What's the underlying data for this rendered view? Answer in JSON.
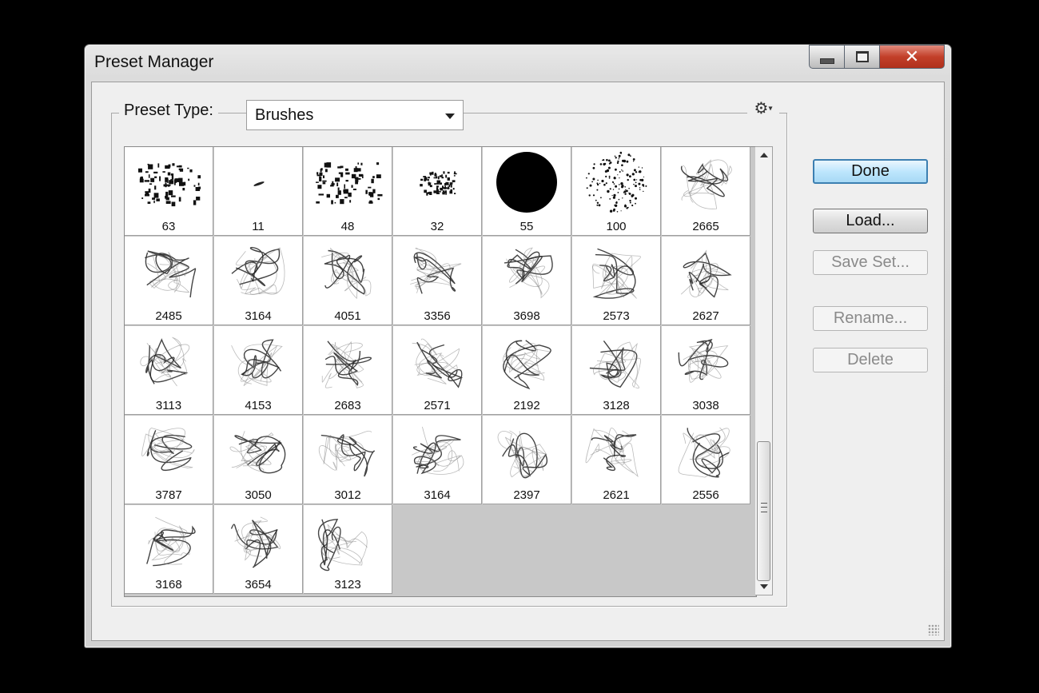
{
  "window": {
    "title": "Preset Manager",
    "close_glyph": "✕"
  },
  "preset": {
    "label": "Preset Type:",
    "selected": "Brushes"
  },
  "menu_icon": "gear-icon",
  "brushes": [
    {
      "size": "63",
      "kind": "splatter"
    },
    {
      "size": "11",
      "kind": "dash"
    },
    {
      "size": "48",
      "kind": "splatter"
    },
    {
      "size": "32",
      "kind": "splatter-small"
    },
    {
      "size": "55",
      "kind": "hard-round"
    },
    {
      "size": "100",
      "kind": "spatter-circle"
    },
    {
      "size": "2665",
      "kind": "smoke"
    },
    {
      "size": "2485",
      "kind": "smoke"
    },
    {
      "size": "3164",
      "kind": "smoke"
    },
    {
      "size": "4051",
      "kind": "smoke"
    },
    {
      "size": "3356",
      "kind": "smoke"
    },
    {
      "size": "3698",
      "kind": "smoke"
    },
    {
      "size": "2573",
      "kind": "smoke"
    },
    {
      "size": "2627",
      "kind": "smoke"
    },
    {
      "size": "3113",
      "kind": "smoke"
    },
    {
      "size": "4153",
      "kind": "smoke"
    },
    {
      "size": "2683",
      "kind": "smoke"
    },
    {
      "size": "2571",
      "kind": "smoke"
    },
    {
      "size": "2192",
      "kind": "smoke"
    },
    {
      "size": "3128",
      "kind": "smoke"
    },
    {
      "size": "3038",
      "kind": "smoke"
    },
    {
      "size": "3787",
      "kind": "smoke"
    },
    {
      "size": "3050",
      "kind": "smoke"
    },
    {
      "size": "3012",
      "kind": "smoke"
    },
    {
      "size": "3164",
      "kind": "smoke"
    },
    {
      "size": "2397",
      "kind": "smoke"
    },
    {
      "size": "2621",
      "kind": "smoke"
    },
    {
      "size": "2556",
      "kind": "smoke"
    },
    {
      "size": "3168",
      "kind": "smoke"
    },
    {
      "size": "3654",
      "kind": "smoke"
    },
    {
      "size": "3123",
      "kind": "smoke"
    }
  ],
  "buttons": {
    "done": "Done",
    "load": "Load...",
    "save_set": "Save Set...",
    "rename": "Rename...",
    "delete": "Delete"
  },
  "colors": {
    "default_button_border": "#3c7fb1",
    "close_button": "#c2402a",
    "empty_grid": "#c8c8c8"
  }
}
